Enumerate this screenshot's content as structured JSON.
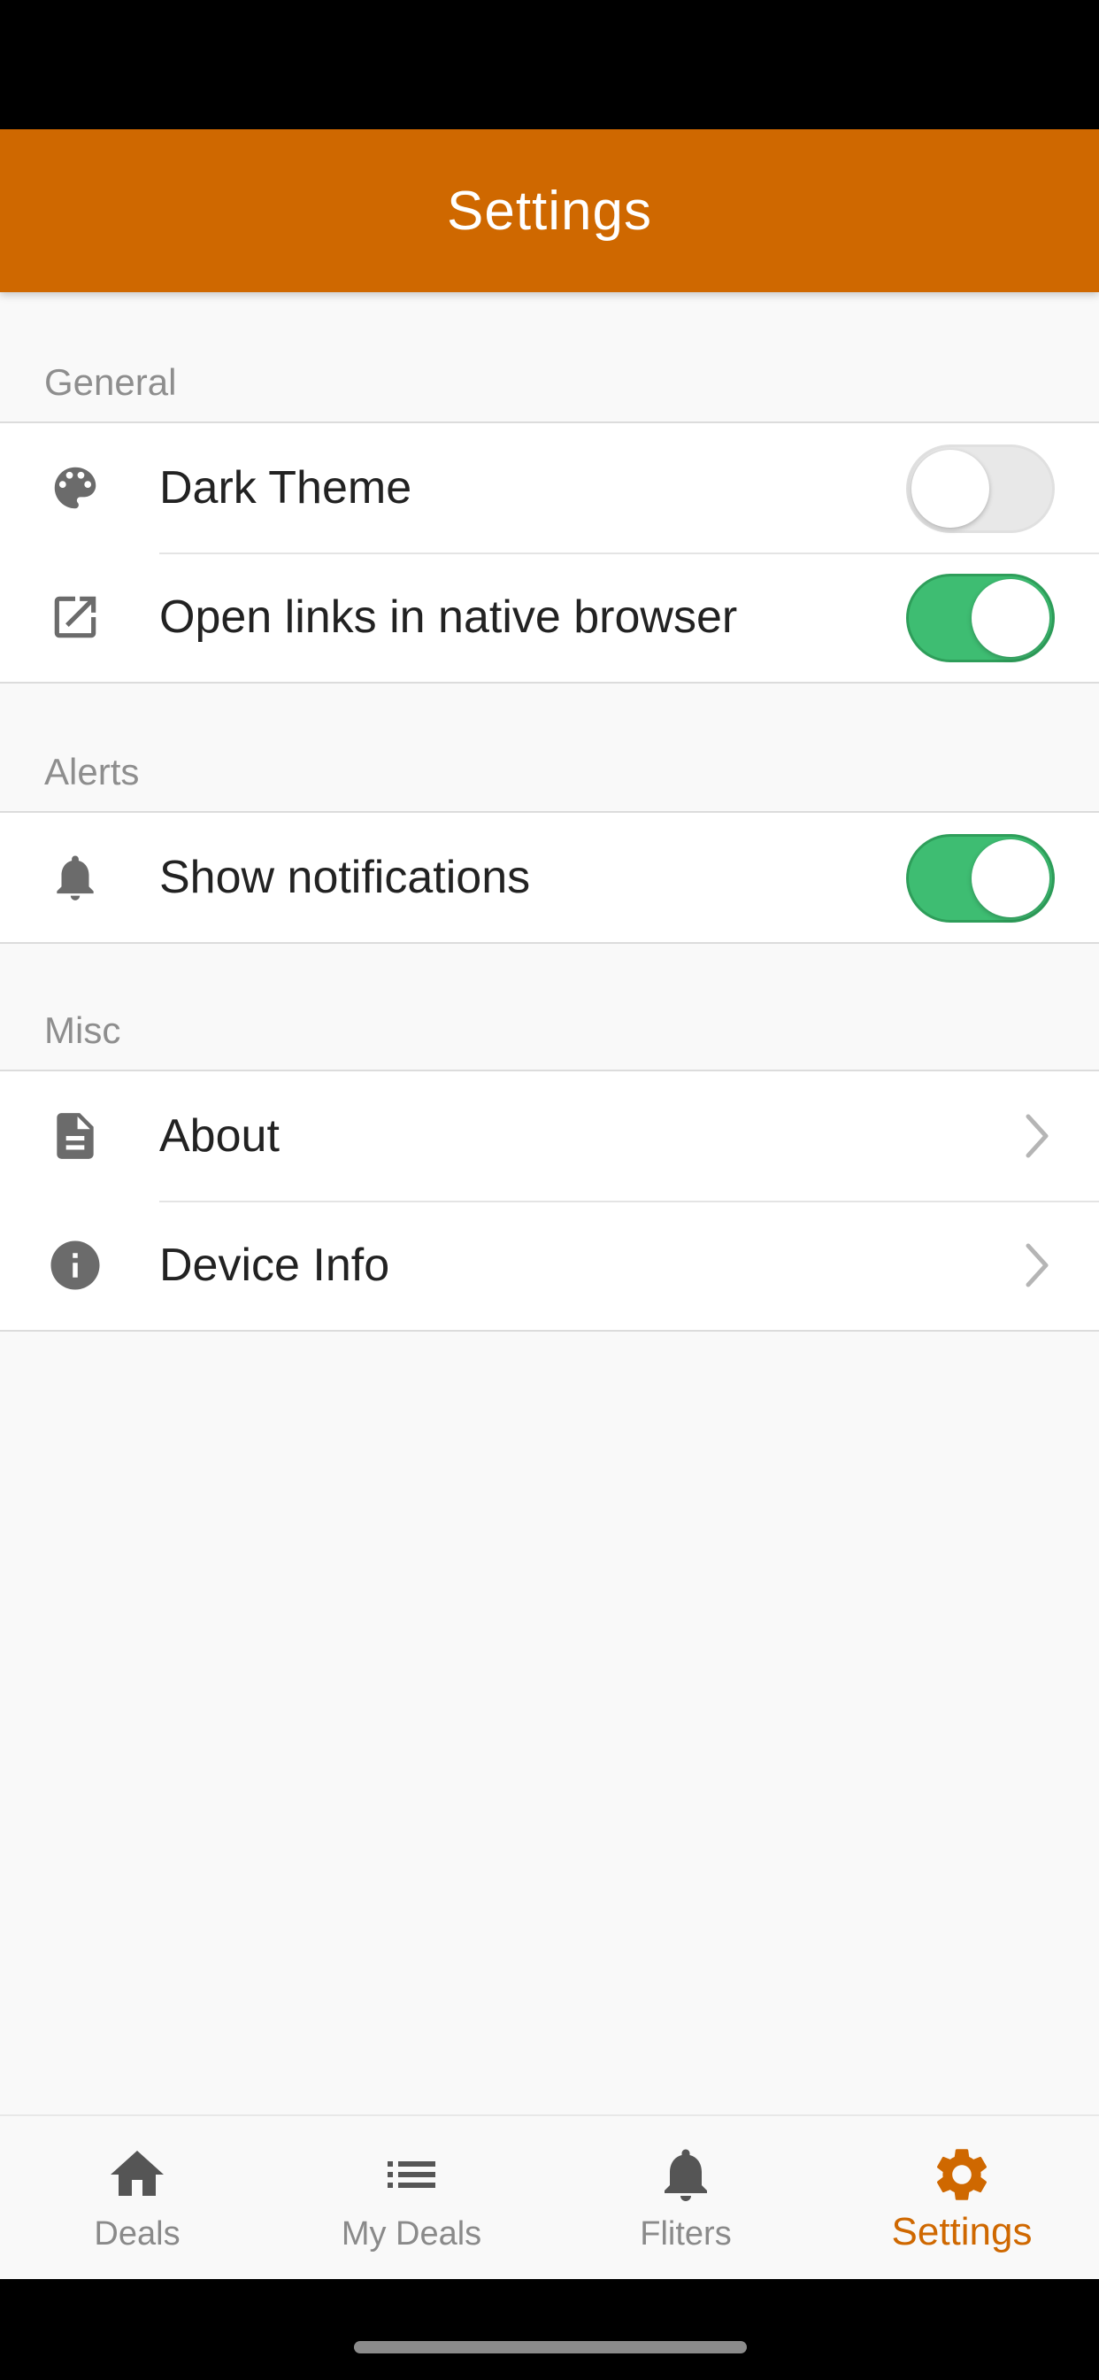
{
  "header": {
    "title": "Settings"
  },
  "sections": {
    "general": {
      "title": "General",
      "items": [
        {
          "label": "Dark Theme",
          "icon": "palette-icon",
          "toggle": false
        },
        {
          "label": "Open links in native browser",
          "icon": "open-external-icon",
          "toggle": true
        }
      ]
    },
    "alerts": {
      "title": "Alerts",
      "items": [
        {
          "label": "Show notifications",
          "icon": "bell-icon",
          "toggle": true
        }
      ]
    },
    "misc": {
      "title": "Misc",
      "items": [
        {
          "label": "About",
          "icon": "document-icon"
        },
        {
          "label": "Device Info",
          "icon": "info-icon"
        }
      ]
    }
  },
  "tabs": [
    {
      "label": "Deals",
      "icon": "home-icon"
    },
    {
      "label": "My Deals",
      "icon": "list-icon"
    },
    {
      "label": "Fliters",
      "icon": "bell-icon"
    },
    {
      "label": "Settings",
      "icon": "gear-icon",
      "active": true
    }
  ],
  "colors": {
    "brand": "#cf6800",
    "toggle_on": "#3ebd72",
    "icon_gray": "#6b6b6b"
  }
}
